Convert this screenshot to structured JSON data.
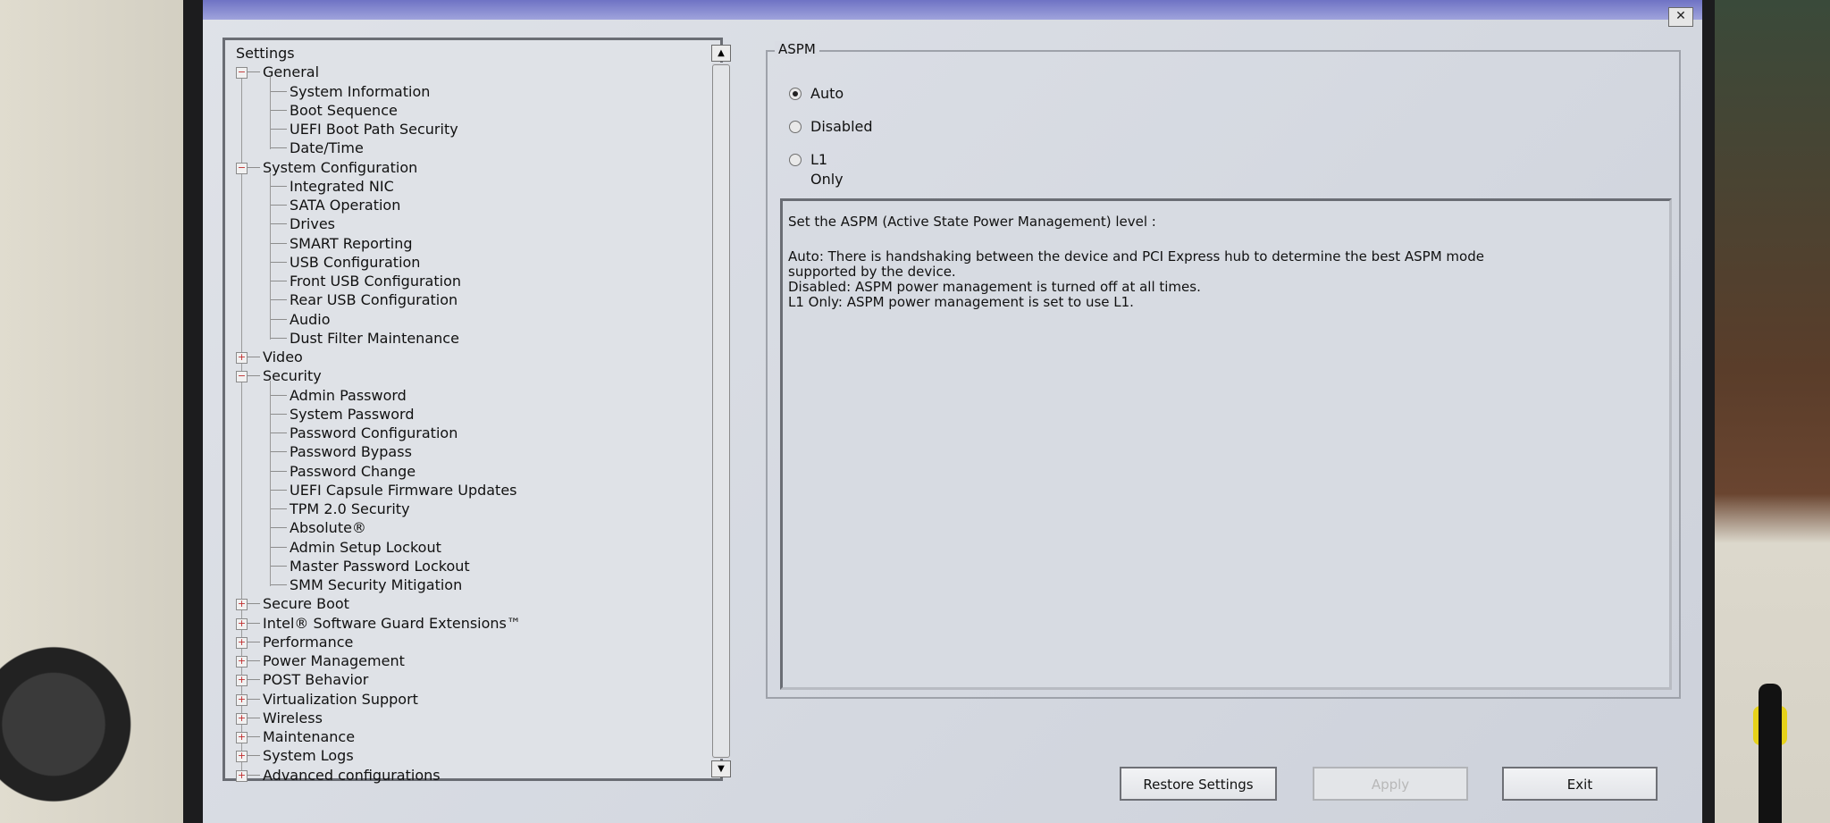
{
  "window": {
    "close_label": "✕"
  },
  "tree": {
    "root_label": "Settings",
    "groups": [
      {
        "label": "General",
        "expanded": true,
        "items": [
          "System Information",
          "Boot Sequence",
          "UEFI Boot Path Security",
          "Date/Time"
        ]
      },
      {
        "label": "System Configuration",
        "expanded": true,
        "items": [
          "Integrated NIC",
          "SATA Operation",
          "Drives",
          "SMART Reporting",
          "USB Configuration",
          "Front USB Configuration",
          "Rear USB Configuration",
          "Audio",
          "Dust Filter Maintenance"
        ]
      },
      {
        "label": "Video",
        "expanded": false,
        "items": []
      },
      {
        "label": "Security",
        "expanded": true,
        "items": [
          "Admin Password",
          "System Password",
          "Password Configuration",
          "Password Bypass",
          "Password Change",
          "UEFI Capsule Firmware Updates",
          "TPM 2.0 Security",
          "Absolute®",
          "Admin Setup Lockout",
          "Master Password Lockout",
          "SMM Security Mitigation"
        ]
      },
      {
        "label": "Secure Boot",
        "expanded": false,
        "items": []
      },
      {
        "label": "Intel® Software Guard Extensions™",
        "expanded": false,
        "items": []
      },
      {
        "label": "Performance",
        "expanded": false,
        "items": []
      },
      {
        "label": "Power Management",
        "expanded": false,
        "items": []
      },
      {
        "label": "POST Behavior",
        "expanded": false,
        "items": []
      },
      {
        "label": "Virtualization Support",
        "expanded": false,
        "items": []
      },
      {
        "label": "Wireless",
        "expanded": false,
        "items": []
      },
      {
        "label": "Maintenance",
        "expanded": false,
        "items": []
      },
      {
        "label": "System Logs",
        "expanded": false,
        "items": []
      },
      {
        "label": "Advanced configurations",
        "expanded": false,
        "items": []
      }
    ]
  },
  "aspm": {
    "legend": "ASPM",
    "options": [
      "Auto",
      "Disabled",
      "L1 Only"
    ],
    "selected": "Auto",
    "help_lines": [
      "Set the ASPM (Active State Power Management) level :",
      "",
      "Auto: There is handshaking between the device and PCI Express hub to determine the best ASPM mode",
      "supported by the device.",
      "Disabled: ASPM power management is turned off at all times.",
      "L1 Only: ASPM power management is set to use L1."
    ]
  },
  "buttons": {
    "restore": "Restore Settings",
    "apply": "Apply",
    "exit": "Exit"
  },
  "icons": {
    "expanded": "minus-box-icon",
    "collapsed": "plus-box-icon",
    "radio": "radio-icon",
    "scroll_up": "arrow-up-icon",
    "scroll_down": "arrow-down-icon"
  }
}
